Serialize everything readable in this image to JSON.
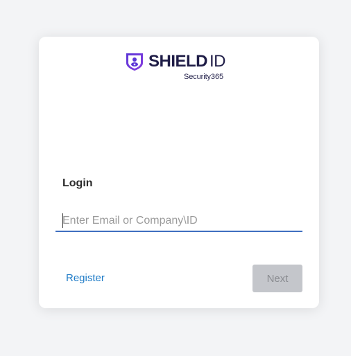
{
  "brand": {
    "name_bold": "SHIELD",
    "name_light": "ID",
    "tagline": "Security365",
    "primary_color": "#1f1d47",
    "shield_color": "#6b3fd6"
  },
  "login": {
    "heading": "Login",
    "email_placeholder": "Enter Email or Company\\ID",
    "email_value": ""
  },
  "actions": {
    "register_label": "Register",
    "next_label": "Next",
    "next_disabled": true
  },
  "colors": {
    "link": "#1e7bc7",
    "input_underline": "#3f6fc0",
    "disabled_button_bg": "#c4c6cb"
  }
}
